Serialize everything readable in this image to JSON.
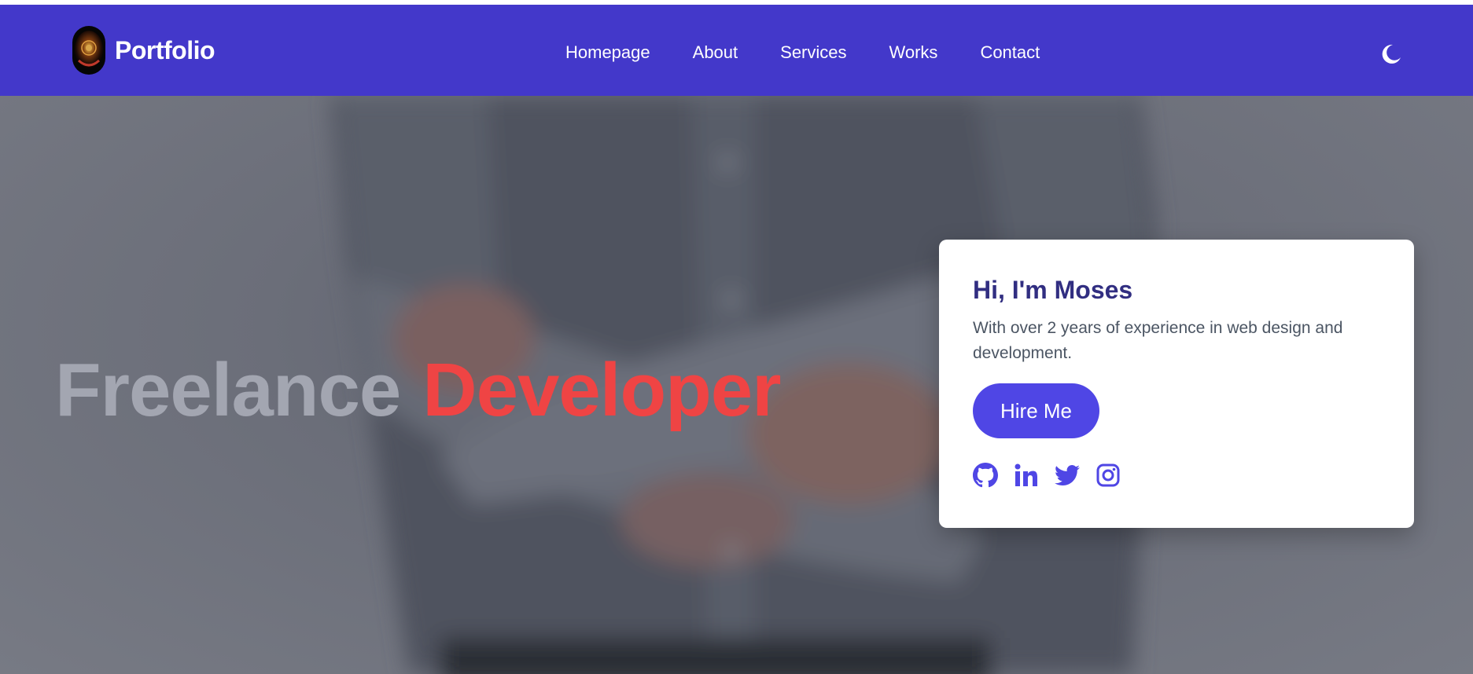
{
  "brand": {
    "name": "Portfolio",
    "logo_icon": "camera-lens-logo"
  },
  "nav": {
    "items": [
      {
        "label": "Homepage"
      },
      {
        "label": "About"
      },
      {
        "label": "Services"
      },
      {
        "label": "Works"
      },
      {
        "label": "Contact"
      }
    ],
    "theme_toggle_icon": "moon-icon"
  },
  "hero": {
    "headline_part1": "Freelance",
    "headline_part2": "Developer",
    "background": "blurred-photo-man-arms-crossed"
  },
  "card": {
    "title": "Hi, I'm Moses",
    "description": "With over 2 years of experience in web design and development.",
    "button_label": "Hire Me",
    "social_icons": [
      "github-icon",
      "linkedin-icon",
      "twitter-icon",
      "instagram-icon"
    ]
  },
  "colors": {
    "navbar": "#4338ca",
    "accent": "#4f46e5",
    "headline_highlight": "#ef4444",
    "headline_muted": "#a3a6b1",
    "card_title": "#312e81"
  }
}
